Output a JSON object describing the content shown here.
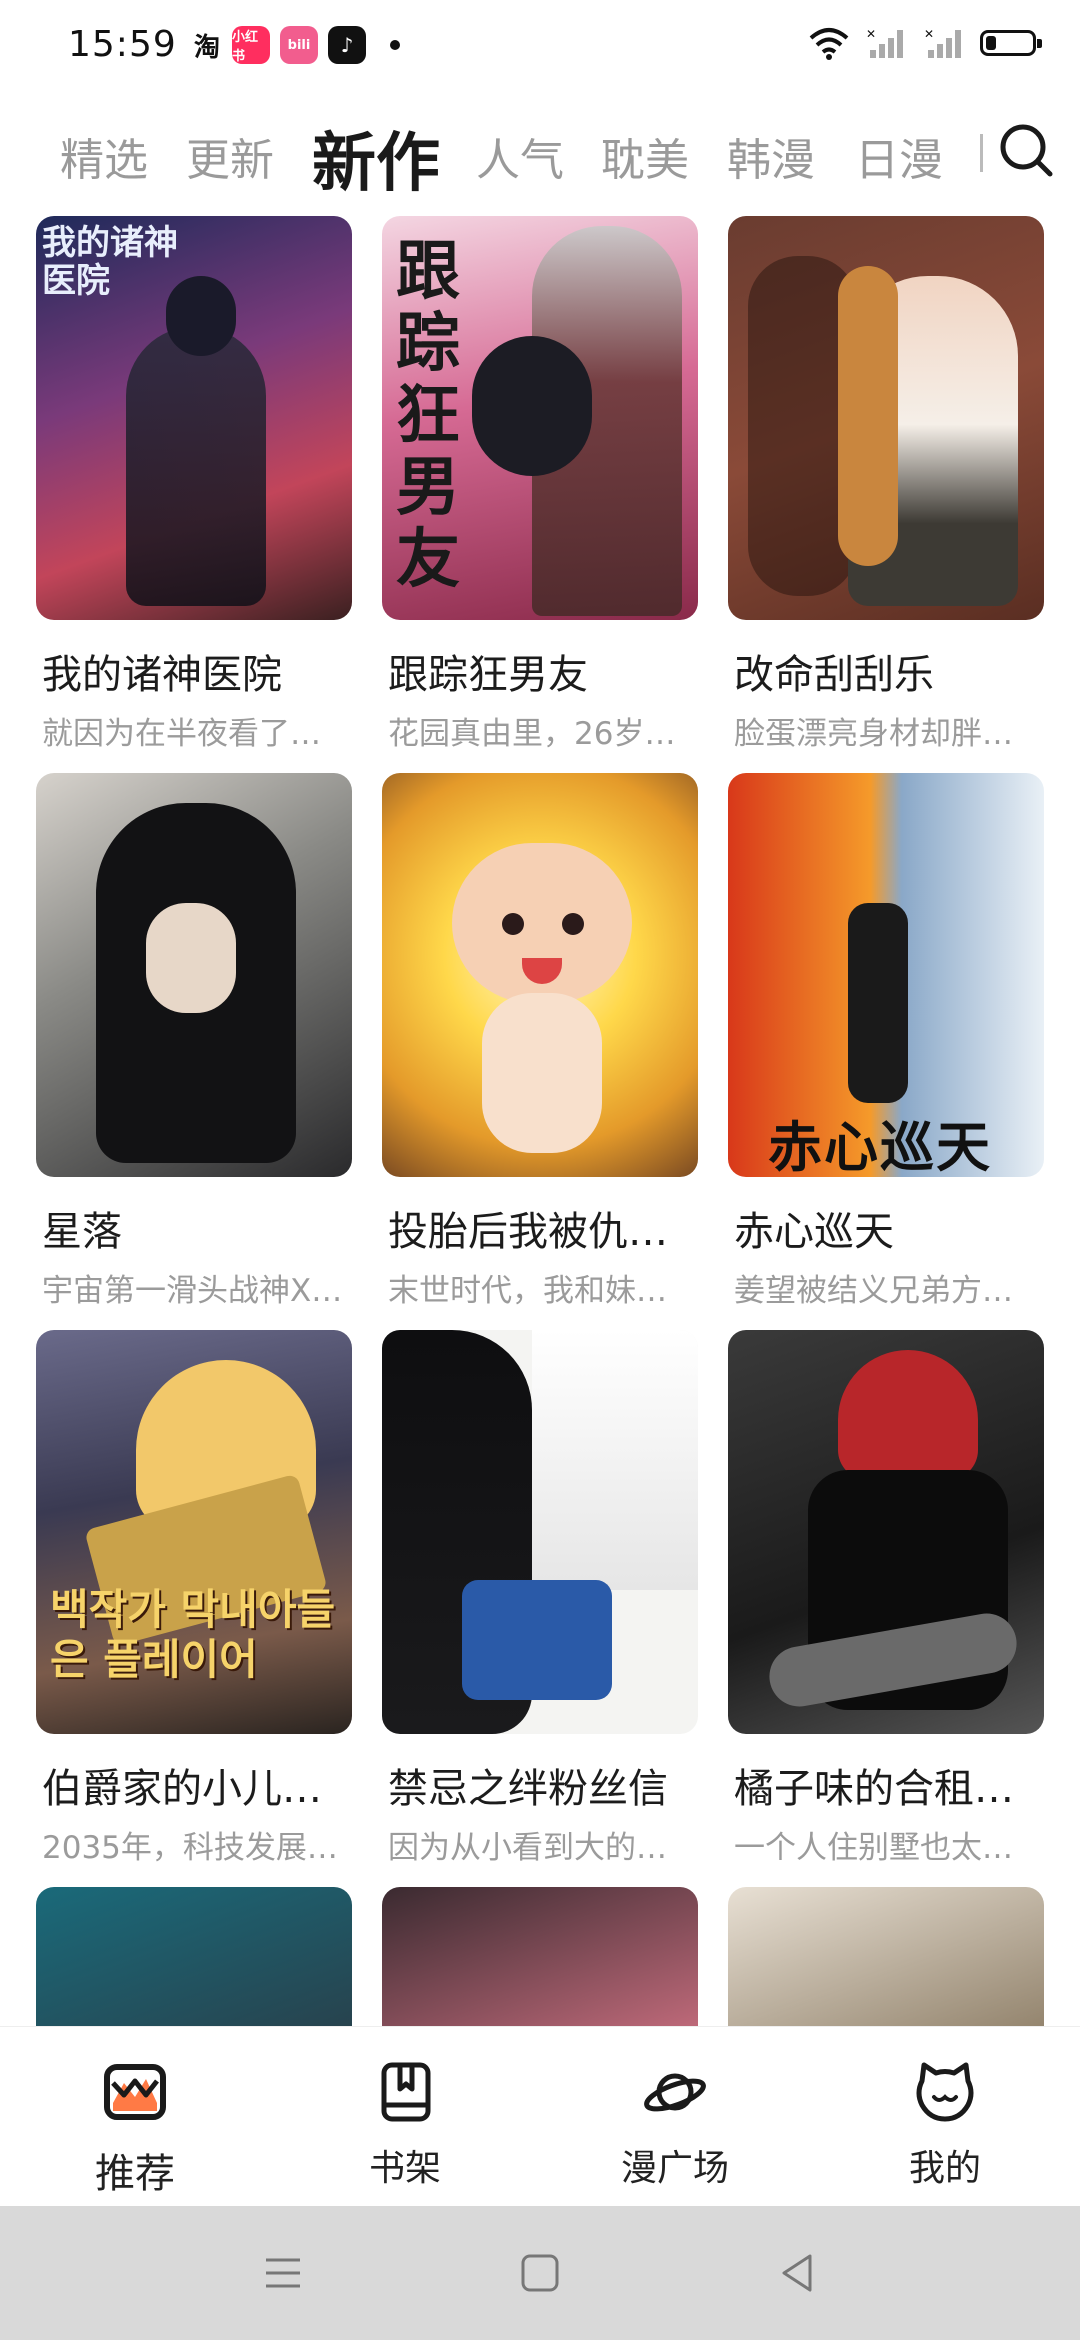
{
  "status_bar": {
    "time": "15:59",
    "app_icons": [
      "taobao-icon",
      "xiaohongshu-icon",
      "bilibili-icon",
      "tiktok-icon"
    ],
    "taobao_label": "淘",
    "xhs_label": "小红书",
    "bili_label": "bili"
  },
  "tabs": [
    {
      "label": "精选",
      "active": false
    },
    {
      "label": "更新",
      "active": false
    },
    {
      "label": "新作",
      "active": true
    },
    {
      "label": "人气",
      "active": false
    },
    {
      "label": "耽美",
      "active": false
    },
    {
      "label": "韩漫",
      "active": false
    },
    {
      "label": "日漫",
      "active": false
    }
  ],
  "comics": [
    {
      "title": "我的诸神医院",
      "desc": "就因为在半夜看了…",
      "cover_text": "我的诸神医院"
    },
    {
      "title": "跟踪狂男友",
      "desc": "花园真由里，26岁…",
      "cover_text": "跟踪狂男友"
    },
    {
      "title": "改命刮刮乐",
      "desc": "脸蛋漂亮身材却胖…",
      "cover_text": ""
    },
    {
      "title": "星落",
      "desc": "宇宙第一滑头战神X…",
      "cover_text": ""
    },
    {
      "title": "投胎后我被仇…",
      "desc": "末世时代，我和妹…",
      "cover_text": ""
    },
    {
      "title": "赤心巡天",
      "desc": "姜望被结义兄弟方…",
      "cover_text": "赤心巡天"
    },
    {
      "title": "伯爵家的小儿…",
      "desc": "2035年，科技发展…",
      "cover_text": "백작가 막내아들은 플레이어"
    },
    {
      "title": "禁忌之绊粉丝信",
      "desc": "因为从小看到大的…",
      "cover_text": ""
    },
    {
      "title": "橘子味的合租…",
      "desc": "一个人住别墅也太…",
      "cover_text": ""
    },
    {
      "title": "",
      "desc": "",
      "cover_text": ""
    },
    {
      "title": "",
      "desc": "",
      "cover_text": ""
    },
    {
      "title": "",
      "desc": "",
      "cover_text": ""
    }
  ],
  "bottom_nav": [
    {
      "label": "推荐",
      "icon": "recommend-icon",
      "active": true
    },
    {
      "label": "书架",
      "icon": "bookshelf-icon",
      "active": false
    },
    {
      "label": "漫广场",
      "icon": "planet-icon",
      "active": false
    },
    {
      "label": "我的",
      "icon": "cat-profile-icon",
      "active": false
    }
  ],
  "colors": {
    "accent": "#ff7a45",
    "active_text": "#1a1a1a",
    "inactive_text": "#9a9a9a",
    "system_nav_bg": "#d9d9d9"
  }
}
